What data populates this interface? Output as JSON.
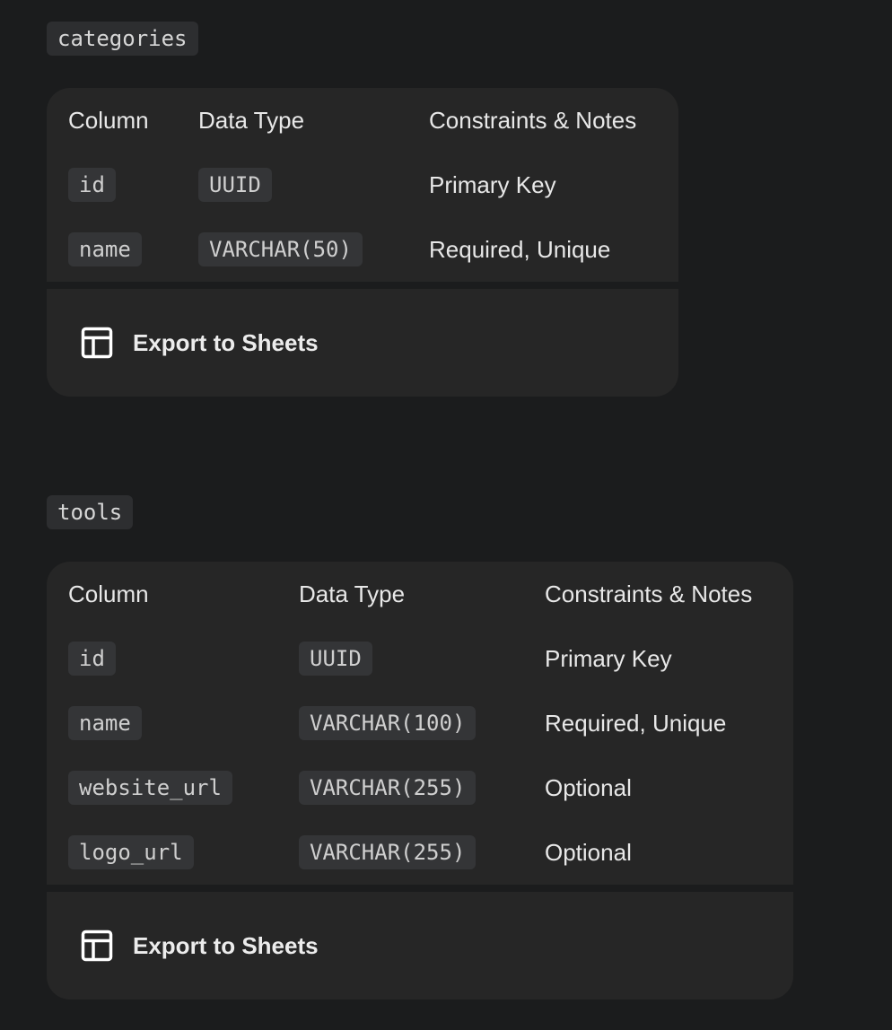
{
  "tables": [
    {
      "name": "categories",
      "headers": [
        "Column",
        "Data Type",
        "Constraints & Notes"
      ],
      "rows": [
        {
          "column": "id",
          "type": "UUID",
          "notes": "Primary Key"
        },
        {
          "column": "name",
          "type": "VARCHAR(50)",
          "notes": "Required, Unique"
        }
      ],
      "export_label": "Export to Sheets",
      "export_icon": "table-icon"
    },
    {
      "name": "tools",
      "headers": [
        "Column",
        "Data Type",
        "Constraints & Notes"
      ],
      "rows": [
        {
          "column": "id",
          "type": "UUID",
          "notes": "Primary Key"
        },
        {
          "column": "name",
          "type": "VARCHAR(100)",
          "notes": "Required, Unique"
        },
        {
          "column": "website_url",
          "type": "VARCHAR(255)",
          "notes": "Optional"
        },
        {
          "column": "logo_url",
          "type": "VARCHAR(255)",
          "notes": "Optional"
        }
      ],
      "export_label": "Export to Sheets",
      "export_icon": "table-icon"
    }
  ]
}
